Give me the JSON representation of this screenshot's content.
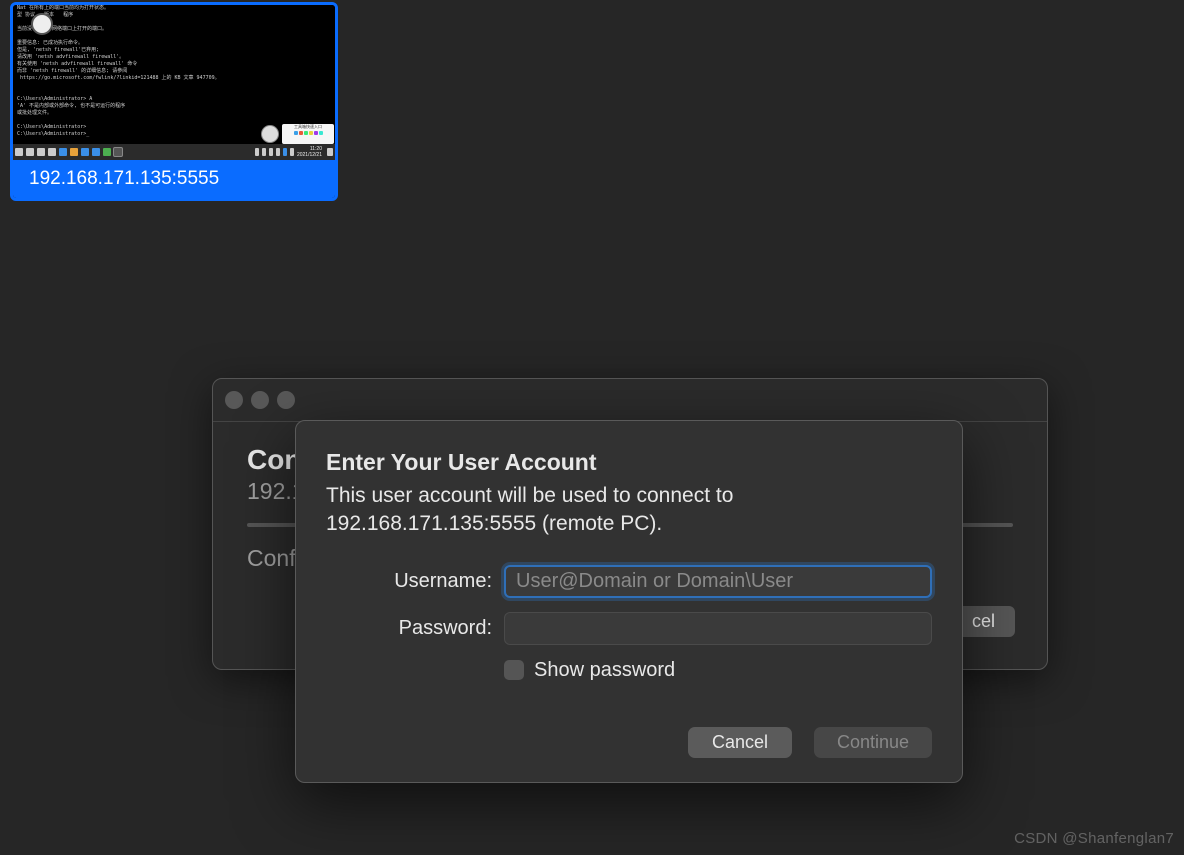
{
  "thumbnail": {
    "label": "192.168.171.135:5555",
    "terminal_lines": "Nat 在所有上的端口当前均为打开状态。\n型 协议   版本   程序\n\n当前没有在所有网络端口上打开的端口。\n\n重要信息: 已成功执行命令。\n但是, 'netsh firewall'已弃用;\n请改用 'netsh advfirewall firewall'。\n有关使用 'netsh advfirewall firewall' 命令\n而非 'netsh firewall' 的详细信息; 请参阅\n https://go.microsoft.com/fwlink/?linkid=121488 上的 KB 文章 947709。\n\n\nC:\\Users\\Administrator> A\n'A' 不是内部或外部命令, 也不是可运行的程序\n或批处理文件。\n\nC:\\Users\\Administrator>\nC:\\Users\\Administrator>_",
    "popup_title": "工具箱快速入口",
    "clock": {
      "time": "11:20",
      "date": "2021/12/21"
    }
  },
  "bg_window": {
    "heading": "Conn",
    "sub": "192.1",
    "conf": "Confi",
    "cancel_fragment": "cel"
  },
  "modal": {
    "title": "Enter Your User Account",
    "description": "This user account will be used to connect to 192.168.171.135:5555 (remote PC).",
    "username_label": "Username:",
    "username_placeholder": "User@Domain or Domain\\User",
    "password_label": "Password:",
    "show_password_label": "Show password",
    "cancel": "Cancel",
    "continue": "Continue"
  },
  "watermark": "CSDN @Shanfenglan7"
}
